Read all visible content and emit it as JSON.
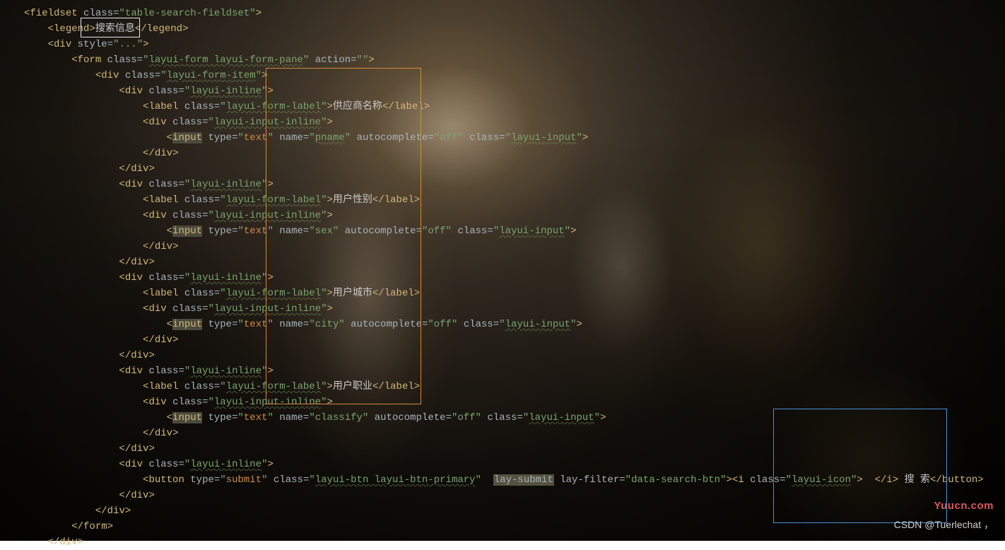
{
  "code": {
    "fieldset_class": "table-search-fieldset",
    "legend_text": "搜索信息",
    "div_style_attr": "...",
    "form_class": "layui-form layui-form-pane",
    "form_action": "",
    "form_item_class": "layui-form-item",
    "inline_class": "layui-inline",
    "label_class": "layui-form-label",
    "input_wrap_class": "layui-input-inline",
    "input_class": "layui-input",
    "input_type": "text",
    "autocomplete": "off",
    "fields": [
      {
        "label": "供应商名称",
        "name": "pname"
      },
      {
        "label": "用户性别",
        "name": "sex"
      },
      {
        "label": "用户城市",
        "name": "city"
      },
      {
        "label": "用户职业",
        "name": "classify"
      }
    ],
    "button_type": "submit",
    "button_class": "layui-btn layui-btn-primary",
    "lay_submit_attr": "lay-submit",
    "lay_filter": "data-search-btn",
    "icon_class": "layui-icon",
    "button_text": "搜 索"
  },
  "overlays": {
    "watermark1": "Yuucn.com",
    "watermark2": "CSDN @Tuerlechat ，"
  }
}
